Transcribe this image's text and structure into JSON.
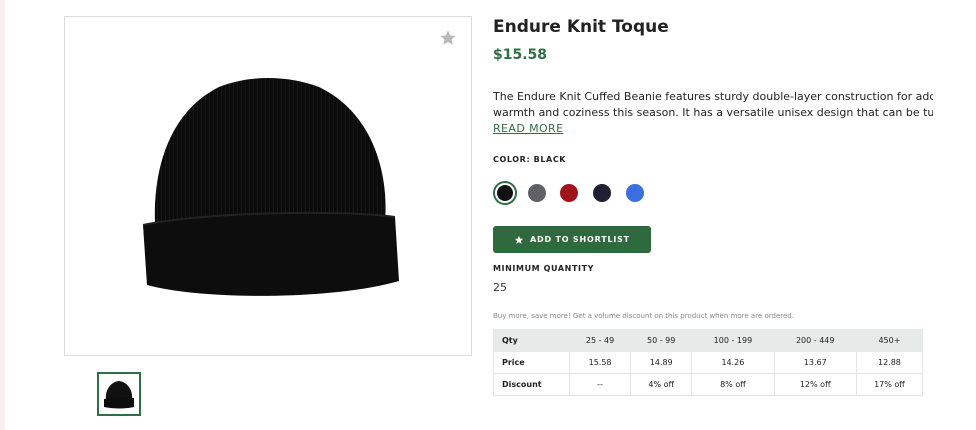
{
  "product": {
    "title": "Endure Knit Toque",
    "price": "$15.58",
    "description_line1": "The Endure Knit Cuffed Beanie features sturdy double-layer construction for added",
    "description_line2": "warmth and coziness this season. It has a versatile unisex design that can be turned...",
    "read_more": "READ MORE"
  },
  "colors": {
    "label": "COLOR: BLACK",
    "selected": "Black",
    "swatches": [
      {
        "name": "Black",
        "hex": "#111111"
      },
      {
        "name": "Charcoal",
        "hex": "#5e6166"
      },
      {
        "name": "Red",
        "hex": "#a0151c"
      },
      {
        "name": "Navy",
        "hex": "#1f2133"
      },
      {
        "name": "Royal Blue",
        "hex": "#3b6fe0"
      }
    ]
  },
  "actions": {
    "shortlist_label": "ADD TO SHORTLIST"
  },
  "minimum_quantity": {
    "label": "MINIMUM QUANTITY",
    "value": "25"
  },
  "volume": {
    "note": "Buy more, save more! Get a volume discount on this product when more are ordered.",
    "headers": [
      "Qty",
      "25 - 49",
      "50 - 99",
      "100 - 199",
      "200 - 449",
      "450+"
    ],
    "price_row": [
      "Price",
      "15.58",
      "14.89",
      "14.26",
      "13.67",
      "12.88"
    ],
    "discount_row": [
      "Discount",
      "--",
      "4% off",
      "8% off",
      "12% off",
      "17% off"
    ]
  },
  "icons": {
    "favorite": "star-icon",
    "shortlist": "star-icon"
  },
  "theme": {
    "accent": "#2f6f45",
    "button": "#2f6a3e"
  }
}
